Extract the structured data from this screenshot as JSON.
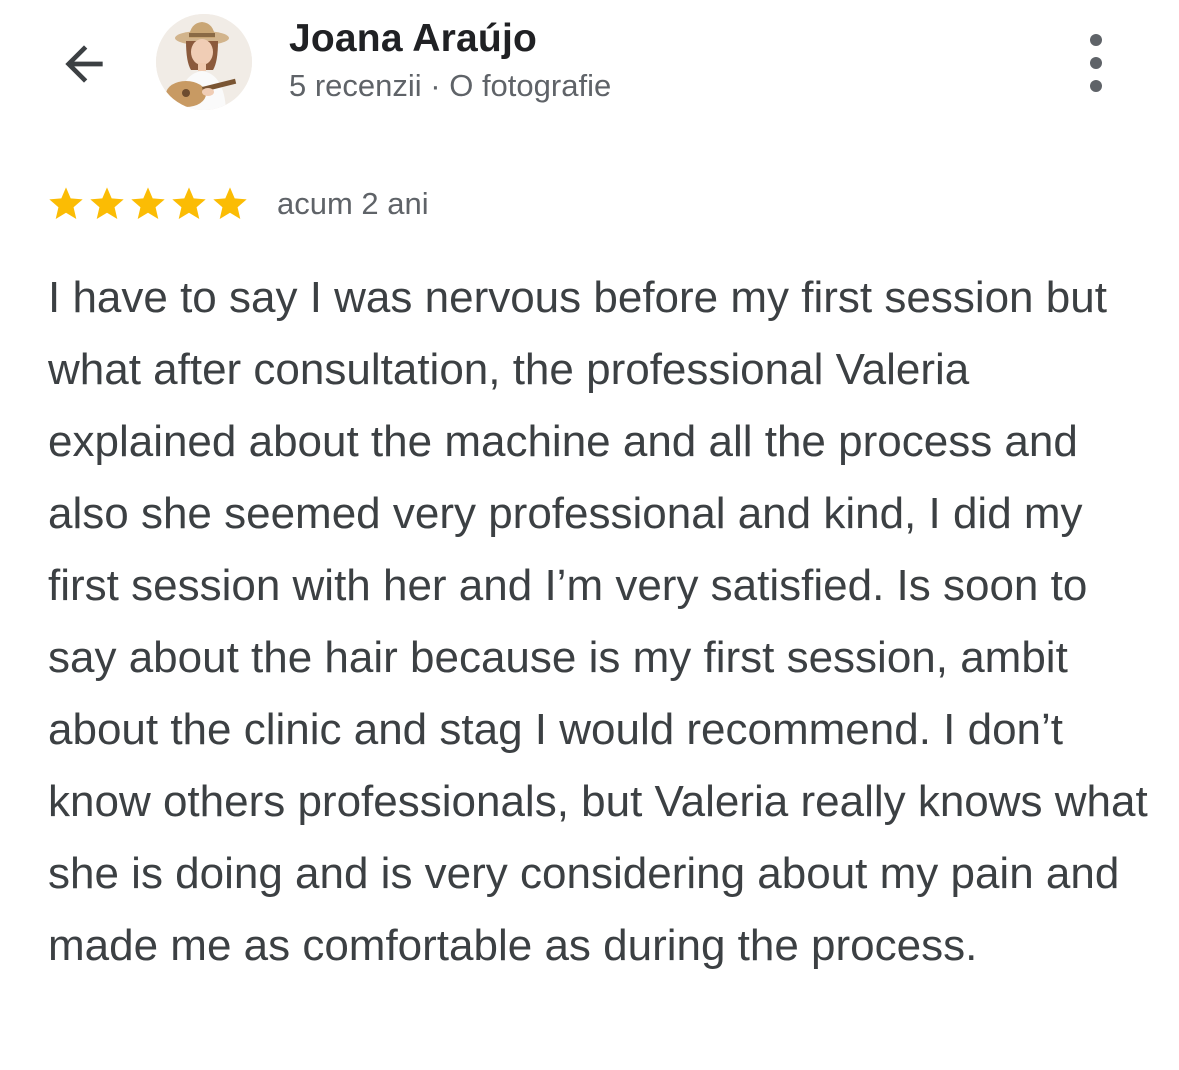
{
  "header": {
    "back_icon": "arrow-back-icon",
    "reviewer_name": "Joana Araújo",
    "reviewer_meta": "5 recenzii · O fotografie",
    "more_icon": "more-vert-icon"
  },
  "review": {
    "rating": 5,
    "rating_max": 5,
    "star_color": "#FBBC04",
    "date": "acum 2 ani",
    "text": "I have to say I was nervous before my first session but what after consultation, the professional Valeria explained about the machine and all the process and also she seemed very professional and kind, I did my first session with her and I’m very satisfied. Is soon to say about the hair because is my first session, ambit about the clinic and stag I would recommend. I don’t know others professionals, but Valeria really knows what she is doing and is very considering about my pain and made me as comfortable as during the process."
  }
}
